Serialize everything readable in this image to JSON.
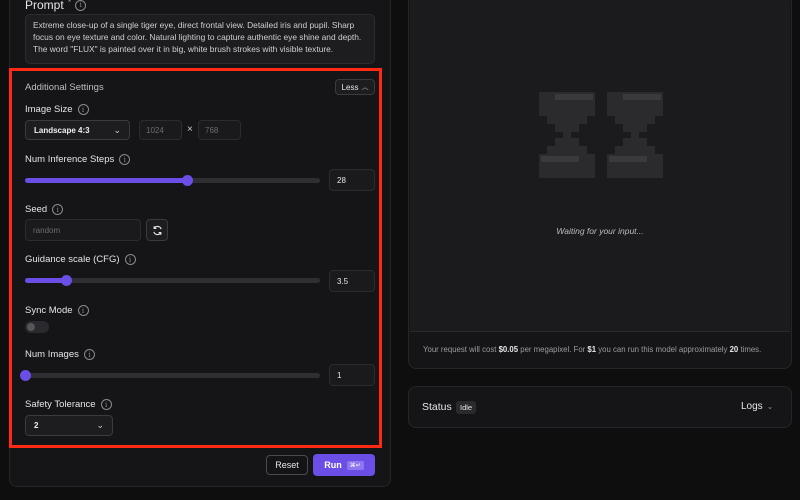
{
  "prompt": {
    "label": "Prompt",
    "required_mark": "*",
    "text": "Extreme close-up of a single tiger eye, direct frontal view. Detailed iris and pupil. Sharp focus on eye texture and color. Natural lighting to capture authentic eye shine and depth. The word \"FLUX\" is painted over it in big, white brush strokes with visible texture."
  },
  "additional_settings": {
    "title": "Additional Settings",
    "toggle_label": "Less",
    "image_size": {
      "label": "Image Size",
      "selected": "Landscape 4:3",
      "width": "1024",
      "height": "768",
      "separator": "×"
    },
    "inference_steps": {
      "label": "Num Inference Steps",
      "value": "28",
      "fill_fraction": 0.55
    },
    "seed": {
      "label": "Seed",
      "placeholder": "random"
    },
    "guidance": {
      "label": "Guidance scale (CFG)",
      "value": "3.5",
      "fill_fraction": 0.14
    },
    "sync_mode": {
      "label": "Sync Mode",
      "enabled": false
    },
    "num_images": {
      "label": "Num Images",
      "value": "1",
      "fill_fraction": 0.0
    },
    "safety_tolerance": {
      "label": "Safety Tolerance",
      "selected": "2"
    }
  },
  "actions": {
    "reset_label": "Reset",
    "run_label": "Run",
    "run_shortcut": "⌘↵"
  },
  "output": {
    "waiting_text": "Waiting for your input...",
    "cost": {
      "prefix": "Your request will cost ",
      "price": "$0.05",
      "mid": " per megapixel. For ",
      "dollar": "$1",
      "mid2": " you can run this model approximately ",
      "count": "20",
      "suffix": " times."
    }
  },
  "status": {
    "label": "Status",
    "badge": "Idle",
    "logs_label": "Logs"
  },
  "colors": {
    "accent": "#6b4ee6",
    "highlight_border": "#ff2a14"
  }
}
